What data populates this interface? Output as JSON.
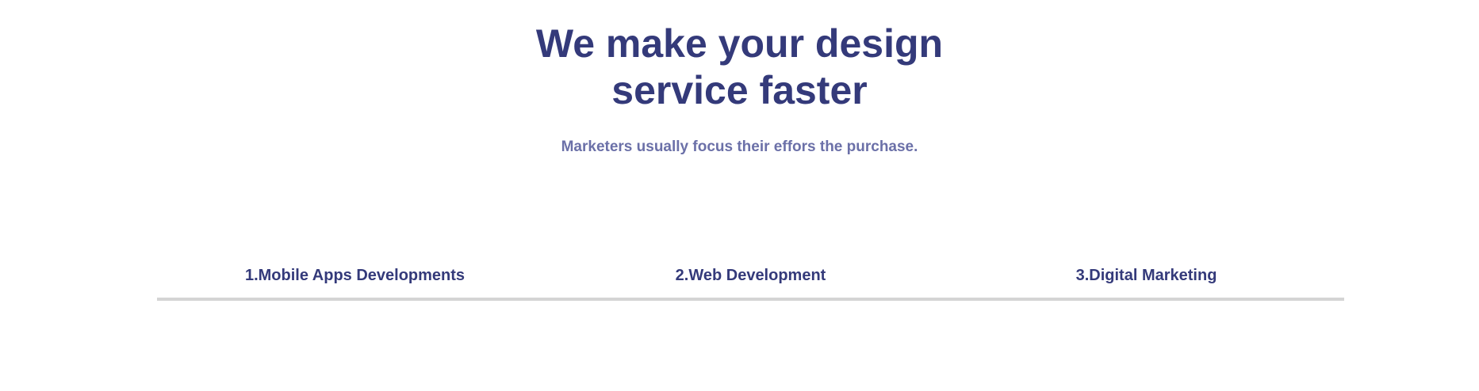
{
  "hero": {
    "title": "We make your design service faster",
    "subtitle": "Marketers usually focus their effors the purchase."
  },
  "tabs": [
    {
      "label": "1.Mobile Apps Developments"
    },
    {
      "label": "2.Web Development"
    },
    {
      "label": "3.Digital Marketing"
    }
  ],
  "colors": {
    "heading": "#343a7a",
    "subtitle": "#6b70a8",
    "divider": "#d4d4d4",
    "background": "#ffffff"
  }
}
